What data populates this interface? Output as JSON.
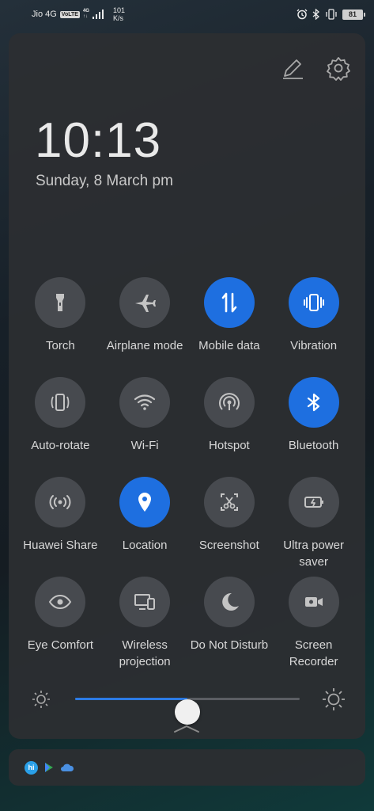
{
  "statusbar": {
    "carrier": "Jio 4G",
    "volte": "VoLTE",
    "net_type": "4G",
    "net_sub": "↑↓",
    "speed_value": "101",
    "speed_unit": "K/s",
    "battery": "81",
    "icons": [
      "alarm-icon",
      "bluetooth-icon",
      "vibrate-icon",
      "battery-icon"
    ]
  },
  "panel": {
    "edit_icon": "pencil-icon",
    "settings_icon": "gear-icon",
    "time": "10:13",
    "date": "Sunday, 8 March  pm"
  },
  "tiles": [
    {
      "label": "Torch",
      "icon": "torch-icon",
      "on": false
    },
    {
      "label": "Airplane mode",
      "icon": "airplane-icon",
      "on": false
    },
    {
      "label": "Mobile data",
      "icon": "mobile-data-icon",
      "on": true
    },
    {
      "label": "Vibration",
      "icon": "vibrate-icon",
      "on": true
    },
    {
      "label": "Auto-rotate",
      "icon": "auto-rotate-icon",
      "on": false
    },
    {
      "label": "Wi-Fi",
      "icon": "wifi-icon",
      "on": false
    },
    {
      "label": "Hotspot",
      "icon": "hotspot-icon",
      "on": false
    },
    {
      "label": "Bluetooth",
      "icon": "bluetooth-icon",
      "on": true
    },
    {
      "label": "Huawei Share",
      "icon": "share-waves-icon",
      "on": false
    },
    {
      "label": "Location",
      "icon": "location-pin-icon",
      "on": true
    },
    {
      "label": "Screenshot",
      "icon": "scissors-icon",
      "on": false
    },
    {
      "label": "Ultra power saver",
      "icon": "battery-bolt-icon",
      "on": false
    },
    {
      "label": "Eye Comfort",
      "icon": "eye-icon",
      "on": false
    },
    {
      "label": "Wireless projection",
      "icon": "projection-icon",
      "on": false
    },
    {
      "label": "Do Not Disturb",
      "icon": "moon-icon",
      "on": false
    },
    {
      "label": "Screen Recorder",
      "icon": "video-camera-icon",
      "on": false
    }
  ],
  "brightness": {
    "level": 0.5
  },
  "notifications": {
    "hi_label": "hi",
    "icons": [
      "hi-assistant-icon",
      "play-store-icon",
      "cloud-icon"
    ]
  },
  "colors": {
    "accent": "#1e6fe0",
    "tile_off": "#474a4f",
    "panel_bg": "#2c2e32"
  }
}
